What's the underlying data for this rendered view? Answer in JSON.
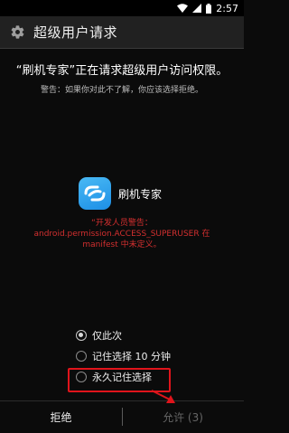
{
  "status_bar": {
    "time": "2:57"
  },
  "app_bar": {
    "title": "超级用户请求",
    "icon": "settings-gear-icon"
  },
  "dialog": {
    "heading": "“刷机专家”正在请求超级用户访问权限。",
    "warning": "警告：如果你对此不了解，你应该选择拒绝。",
    "app_name": "刷机专家",
    "dev_warning_lines": [
      "“开发人员警告：",
      "android.permission.ACCESS_SUPERUSER 在",
      "manifest 中未定义。"
    ]
  },
  "options": [
    {
      "label": "仅此次",
      "checked": true
    },
    {
      "label": "记住选择 10 分钟",
      "checked": false
    },
    {
      "label": "永久记住选择",
      "checked": false
    }
  ],
  "buttons": {
    "deny": "拒绝",
    "allow": "允许 (3)"
  },
  "colors": {
    "warning_red": "#d32f2f",
    "annotation_red": "#e0141b",
    "app_icon_blue": "#2a9be9"
  }
}
